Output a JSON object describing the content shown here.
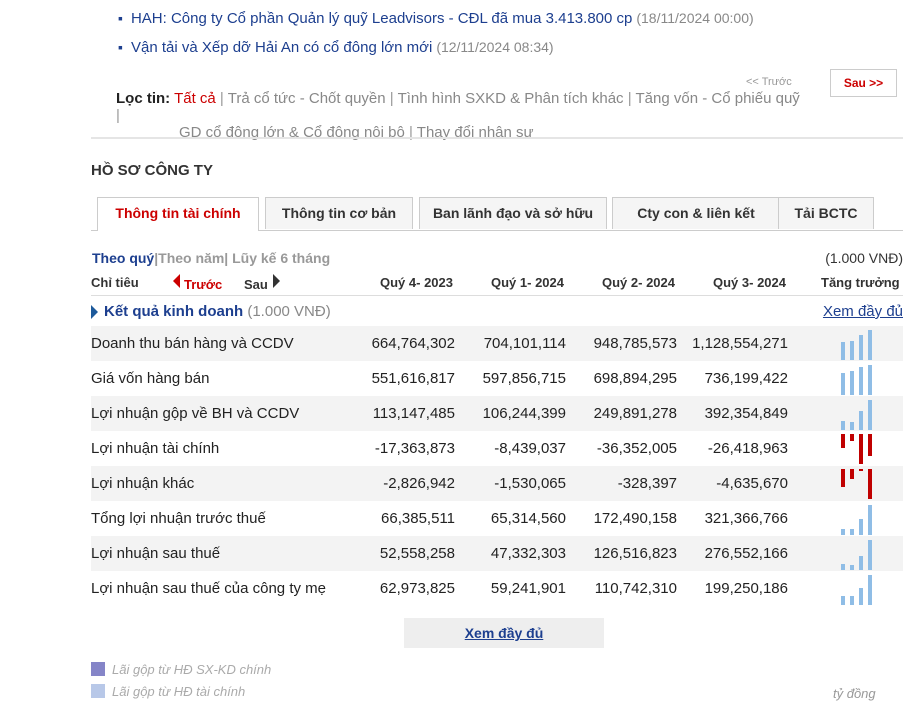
{
  "news": [
    {
      "title": "HAH: Công ty Cổ phần Quản lý quỹ Leadvisors - CĐL đã mua 3.413.800 cp",
      "time": "(18/11/2024 00:00)"
    },
    {
      "title": "Vận tải và Xếp dỡ Hải An có cổ đông lớn mới",
      "time": "(12/11/2024 08:34)"
    }
  ],
  "pager": {
    "prev": "<< Trước",
    "next": "Sau >>"
  },
  "filter": {
    "label": "Lọc tin:",
    "active": "Tất cả",
    "items": [
      "Trả cổ tức - Chốt quyền",
      "Tình hình SXKD & Phân tích khác",
      "Tăng vốn - Cổ phiếu quỹ",
      "GD cổ đông lớn & Cổ đông nội bộ",
      "Thay đổi nhân sự"
    ]
  },
  "profile_title": "HỒ SƠ CÔNG TY",
  "tabs": [
    "Thông tin tài chính",
    "Thông tin cơ bản",
    "Ban lãnh đạo và sở hữu",
    "Cty con & liên kết",
    "Tải BCTC"
  ],
  "period": {
    "quarter": "Theo quý",
    "year": "Theo năm",
    "cum": "Lũy kế 6 tháng",
    "unit": "(1.000 VNĐ)"
  },
  "table": {
    "col_label": "Chỉ tiêu",
    "prev": "Trước",
    "next": "Sau",
    "quarters": [
      "Quý 4- 2023",
      "Quý 1- 2024",
      "Quý 2- 2024",
      "Quý 3- 2024"
    ],
    "growth": "Tăng trưởng",
    "section_title": "Kết quả kinh doanh",
    "section_unit": "(1.000 VNĐ)",
    "see_all": "Xem đầy đủ",
    "rows": [
      {
        "name": "Doanh thu bán hàng và CCDV",
        "values": [
          "664,764,302",
          "704,101,114",
          "948,785,573",
          "1,128,554,271"
        ],
        "nums": [
          664764302,
          704101114,
          948785573,
          1128554271
        ]
      },
      {
        "name": "Giá vốn hàng bán",
        "values": [
          "551,616,817",
          "597,856,715",
          "698,894,295",
          "736,199,422"
        ],
        "nums": [
          551616817,
          597856715,
          698894295,
          736199422
        ]
      },
      {
        "name": "Lợi nhuận gộp về BH và CCDV",
        "values": [
          "113,147,485",
          "106,244,399",
          "249,891,278",
          "392,354,849"
        ],
        "nums": [
          113147485,
          106244399,
          249891278,
          392354849
        ]
      },
      {
        "name": "Lợi nhuận tài chính",
        "values": [
          "-17,363,873",
          "-8,439,037",
          "-36,352,005",
          "-26,418,963"
        ],
        "nums": [
          -17363873,
          -8439037,
          -36352005,
          -26418963
        ]
      },
      {
        "name": "Lợi nhuận khác",
        "values": [
          "-2,826,942",
          "-1,530,065",
          "-328,397",
          "-4,635,670"
        ],
        "nums": [
          -2826942,
          -1530065,
          -328397,
          -4635670
        ]
      },
      {
        "name": "Tổng lợi nhuận trước thuế",
        "values": [
          "66,385,511",
          "65,314,560",
          "172,490,158",
          "321,366,766"
        ],
        "nums": [
          66385511,
          65314560,
          172490158,
          321366766
        ]
      },
      {
        "name": "Lợi nhuận sau thuế",
        "values": [
          "52,558,258",
          "47,332,303",
          "126,516,823",
          "276,552,166"
        ],
        "nums": [
          52558258,
          47332303,
          126516823,
          276552166
        ]
      },
      {
        "name": "Lợi nhuận sau thuế của công ty mẹ",
        "values": [
          "62,973,825",
          "59,241,901",
          "110,742,310",
          "199,250,186"
        ],
        "nums": [
          62973825,
          59241901,
          110742310,
          199250186
        ]
      }
    ]
  },
  "bottom_button": "Xem đầy đủ",
  "legend": [
    "Lãi gộp từ HĐ SX-KD chính",
    "Lãi gộp từ HĐ tài chính"
  ],
  "corner_text": "tỷ đồng",
  "colors": {
    "positive_bar": "#8fbde6",
    "negative_bar": "#c00000",
    "legend1": "#8585c8",
    "legend2": "#b8c8e8"
  }
}
